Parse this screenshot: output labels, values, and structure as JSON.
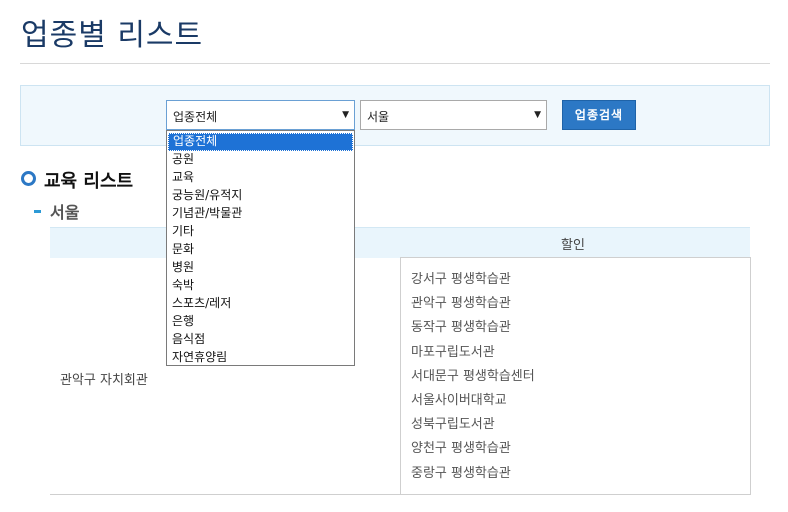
{
  "page": {
    "title": "업종별 리스트"
  },
  "search": {
    "category_select": {
      "value": "업종전체",
      "options": [
        "업종전체",
        "공원",
        "교육",
        "궁능원/유적지",
        "기념관/박물관",
        "기타",
        "문화",
        "병원",
        "숙박",
        "스포츠/레저",
        "은행",
        "음식점",
        "자연휴양림"
      ]
    },
    "region_select": {
      "value": "서울"
    },
    "button_label": "업종검색"
  },
  "section": {
    "title": "교육 리스트",
    "region": "서울"
  },
  "table": {
    "header_discount": "할인",
    "row": {
      "name": "관악구 자치회관",
      "discounts": [
        "강서구 평생학습관",
        "관악구 평생학습관",
        "동작구 평생학습관",
        "마포구립도서관",
        "서대문구 평생학습센터",
        "서울사이버대학교",
        "성북구립도서관",
        "양천구 평생학습관",
        "중랑구 평생학습관"
      ]
    }
  },
  "colors": {
    "accent": "#2c78c5",
    "title": "#1a3a66",
    "panel_bg": "#f0f8fd",
    "highlight": "#1e72d6"
  }
}
